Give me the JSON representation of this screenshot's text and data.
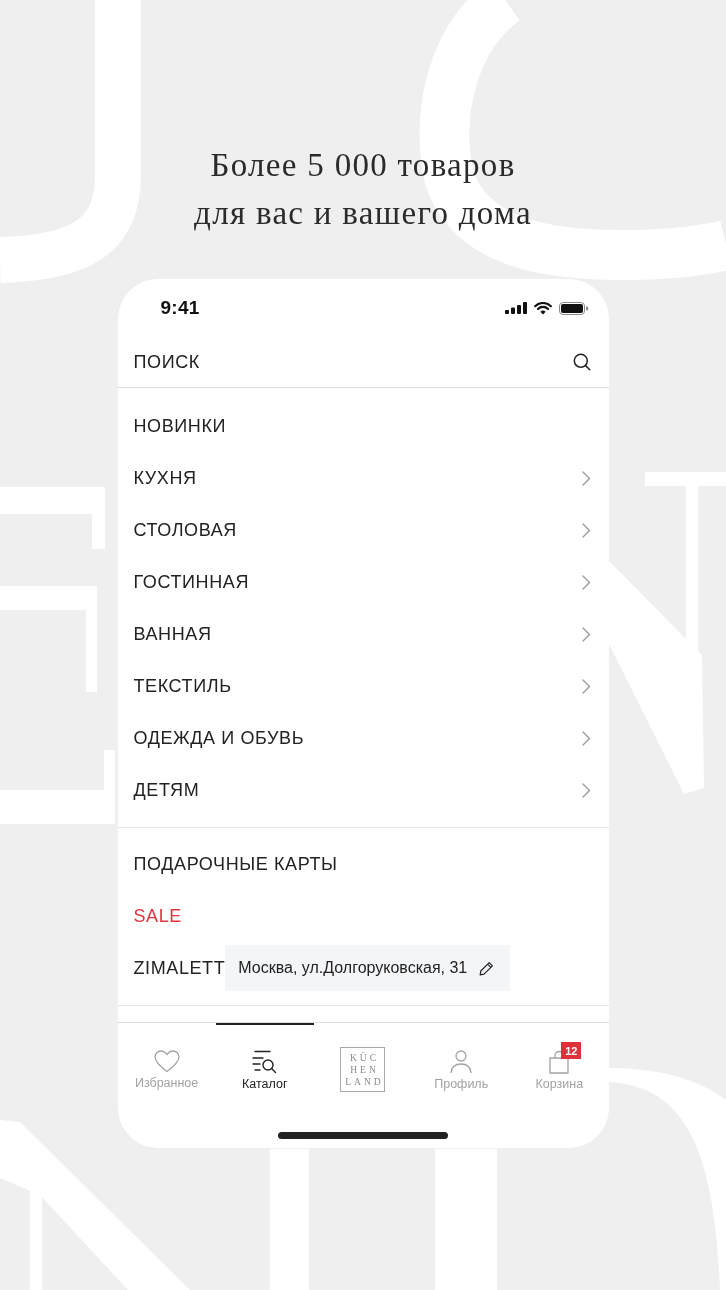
{
  "headline": [
    "Более 5 000 товаров",
    "для вас и вашего дома"
  ],
  "status_bar": {
    "time": "9:41"
  },
  "search": {
    "placeholder": "ПОИСК"
  },
  "menu_sections": [
    {
      "items": [
        {
          "label": "НОВИНКИ",
          "submenu": false
        },
        {
          "label": "КУХНЯ",
          "submenu": true
        },
        {
          "label": "СТОЛОВАЯ",
          "submenu": true
        },
        {
          "label": "ГОСТИННАЯ",
          "submenu": true
        },
        {
          "label": "ВАННАЯ",
          "submenu": true
        },
        {
          "label": "ТЕКСТИЛЬ",
          "submenu": true
        },
        {
          "label": "ОДЕЖДА И ОБУВЬ",
          "submenu": true
        },
        {
          "label": "ДЕТЯМ",
          "submenu": true
        }
      ]
    },
    {
      "items": [
        {
          "label": "ПОДАРОЧНЫЕ КАРТЫ",
          "submenu": false,
          "color": "#222222"
        },
        {
          "label": "SALE",
          "submenu": false,
          "color": "#e0343e"
        },
        {
          "label": "ZIMALETT",
          "submenu": false,
          "color": "#222222",
          "address": "Москва, ул.Долгоруковская, 31"
        }
      ]
    }
  ],
  "tab_bar": [
    {
      "kind": "favorites",
      "label": "Избранное",
      "selected": false
    },
    {
      "kind": "catalog",
      "label": "Каталог",
      "selected": true
    },
    {
      "kind": "logo",
      "lines": [
        "KÜC",
        "HEN",
        "LAND"
      ],
      "selected": false
    },
    {
      "kind": "profile",
      "label": "Профиль",
      "selected": false
    },
    {
      "kind": "cart",
      "label": "Корзина",
      "selected": false,
      "badge": "12"
    }
  ]
}
